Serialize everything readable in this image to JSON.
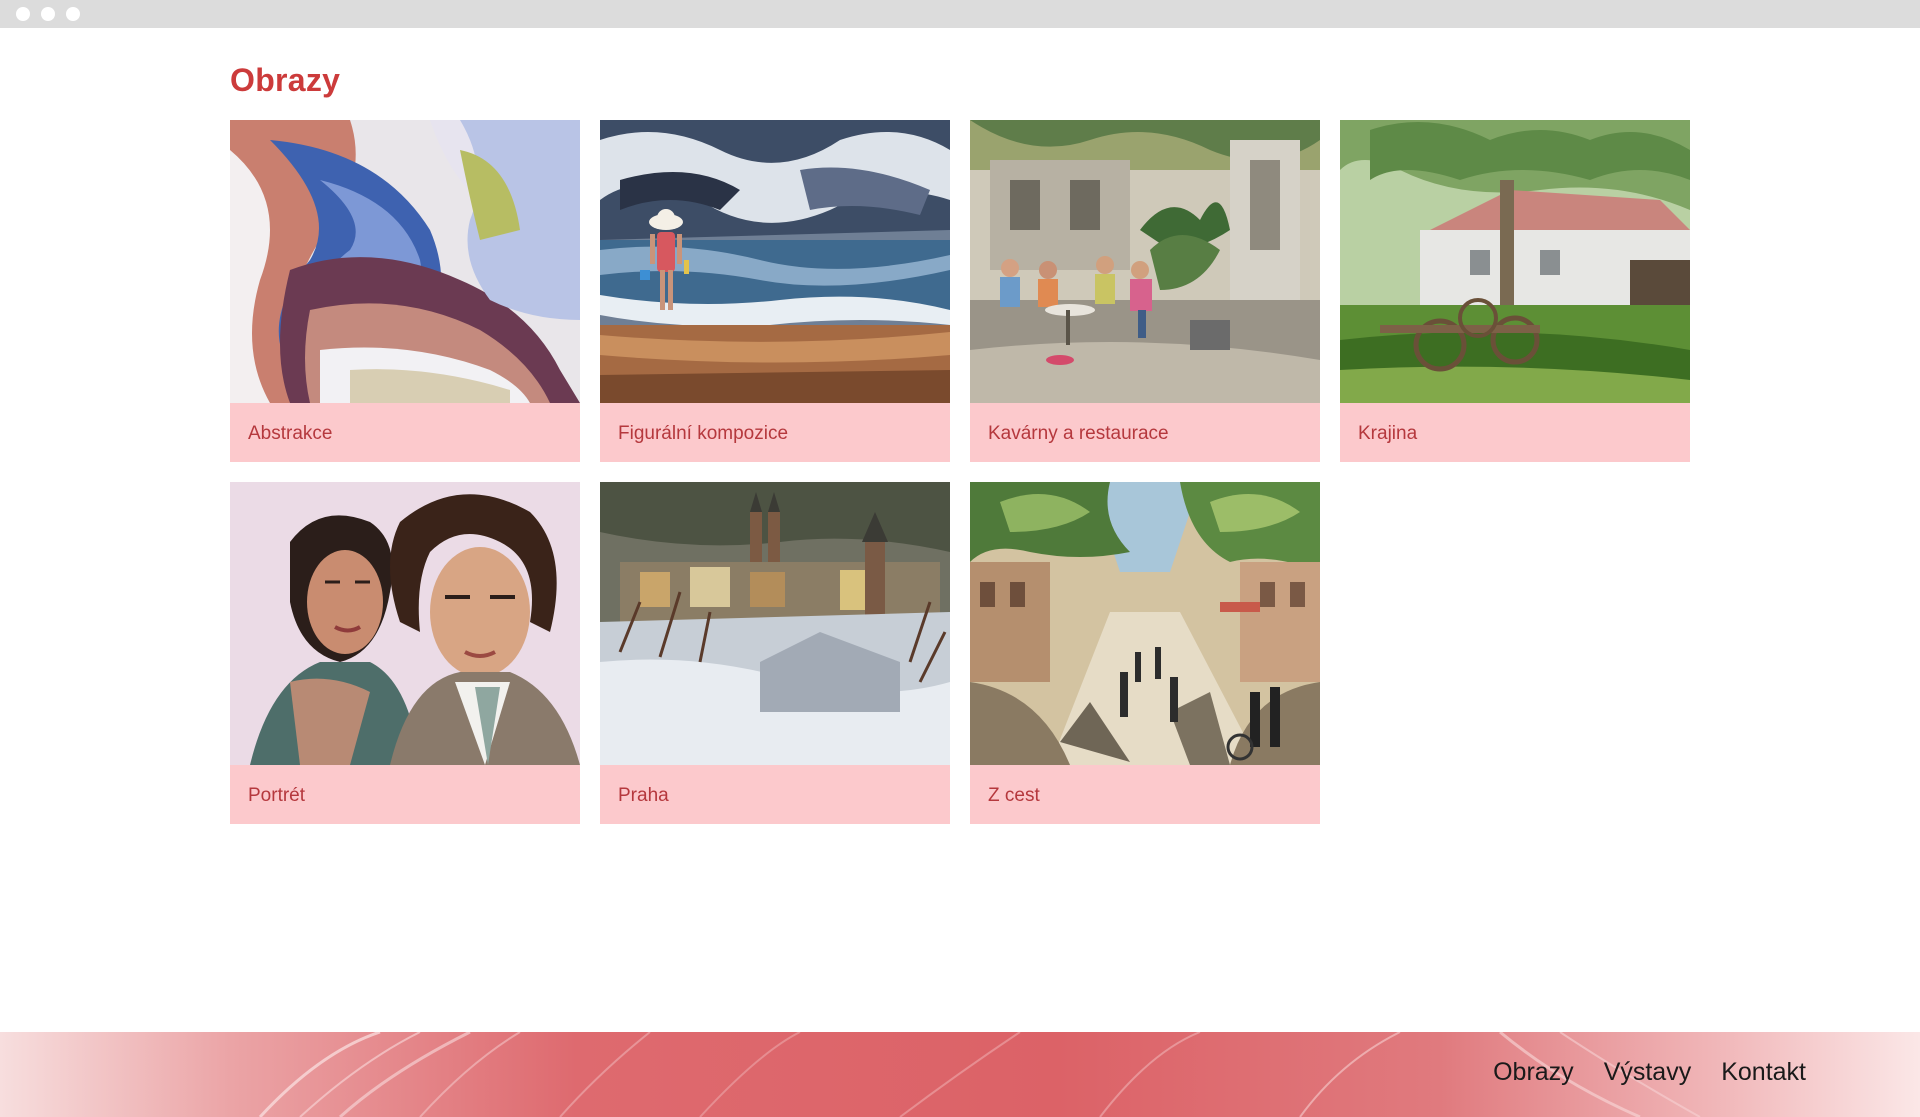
{
  "window": {
    "controls": [
      "window-dot",
      "window-dot",
      "window-dot"
    ]
  },
  "page": {
    "title": "Obrazy"
  },
  "gallery": {
    "items": [
      {
        "label": "Abstrakce",
        "image": "abstract-painting"
      },
      {
        "label": "Figurální kompozice",
        "image": "beach-figure-painting"
      },
      {
        "label": "Kavárny a restaurace",
        "image": "cafe-terrace-painting"
      },
      {
        "label": "Krajina",
        "image": "countryside-cart-painting"
      },
      {
        "label": "Portrét",
        "image": "couple-portrait-painting"
      },
      {
        "label": "Praha",
        "image": "prague-winter-painting"
      },
      {
        "label": "Z cest",
        "image": "street-avenue-painting"
      }
    ]
  },
  "footer": {
    "nav": [
      "Obrazy",
      "Výstavy",
      "Kontakt"
    ]
  },
  "colors": {
    "title": "#cc3b3b",
    "card_background": "#fcc9cc",
    "card_label": "#b5383d",
    "footer_accent": "#dc6267",
    "window_bar": "#dcdcdc"
  }
}
